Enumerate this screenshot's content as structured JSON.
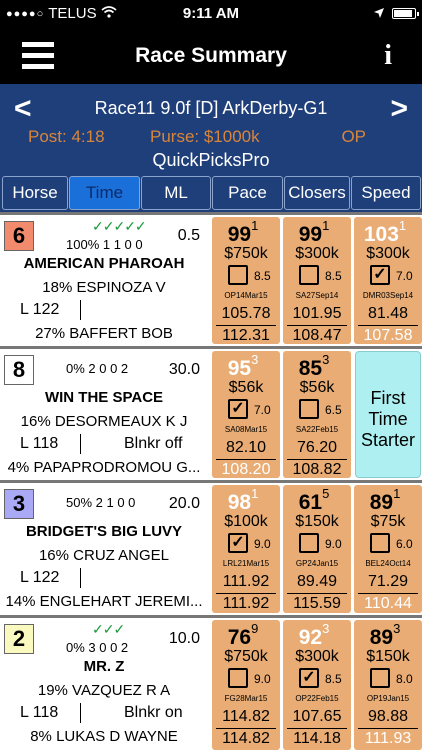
{
  "status_bar": {
    "carrier": "TELUS",
    "time": "9:11 AM"
  },
  "nav": {
    "title": "Race Summary",
    "info_label": "i"
  },
  "race": {
    "title": "Race11  9.0f  [D]  ArkDerby-G1",
    "post": "Post: 4:18",
    "purse": "Purse: $1000k",
    "type": "OP",
    "source": "QuickPicksPro",
    "prev_arrow": "<",
    "next_arrow": ">"
  },
  "tabs": [
    "Horse",
    "Time",
    "ML",
    "Pace",
    "Closers",
    "Speed"
  ],
  "active_tab": "Time",
  "colors": {
    "header_bg": "#1f3f7a",
    "tab_active": "#1a6fd8",
    "card": "#e8ac74",
    "first_time": "#aef0f2",
    "accent_orange": "#d9853a",
    "check_green": "#1a9a3a"
  },
  "horses": [
    {
      "pp": "6",
      "pp_color": "#f28b6e",
      "checks": "✓✓✓✓✓",
      "stats": "100% 1 1 0 0",
      "ml": "0.5",
      "name": "AMERICAN PHAROAH",
      "jockey": "18% ESPINOZA V",
      "weight": "L 122",
      "equip": "",
      "trainer": "27% BAFFERT BOB",
      "races": [
        {
          "fig": "99",
          "sup": "1",
          "claim": "$750k",
          "checked": false,
          "odds": "8.5",
          "date": "OP14Mar15",
          "t1": "105.78",
          "t2": "112.31",
          "t2_white": false
        },
        {
          "fig": "99",
          "sup": "1",
          "claim": "$300k",
          "checked": false,
          "odds": "8.5",
          "date": "SA27Sep14",
          "t1": "101.95",
          "t2": "108.47",
          "t2_white": false
        },
        {
          "fig": "103",
          "sup": "1",
          "claim": "$300k",
          "checked": true,
          "odds": "7.0",
          "date": "DMR03Sep14",
          "t1": "81.48",
          "t2": "107.58",
          "t2_white": true,
          "fig_white": true
        }
      ]
    },
    {
      "pp": "8",
      "pp_color": "#ffffff",
      "checks": "",
      "stats": "0% 2 0 0 2",
      "ml": "30.0",
      "name": "WIN THE SPACE",
      "jockey": "16% DESORMEAUX K J",
      "weight": "L 118",
      "equip": "Blnkr off",
      "trainer": "4% PAPAPRODROMOU G...",
      "races": [
        {
          "fig": "95",
          "sup": "3",
          "claim": "$56k",
          "checked": true,
          "odds": "7.0",
          "date": "SA08Mar15",
          "t1": "82.10",
          "t2": "108.20",
          "t2_white": true,
          "fig_white": true
        },
        {
          "fig": "85",
          "sup": "3",
          "claim": "$56k",
          "checked": false,
          "odds": "6.5",
          "date": "SA22Feb15",
          "t1": "76.20",
          "t2": "108.82",
          "t2_white": false
        }
      ],
      "first_time": "First Time Starter"
    },
    {
      "pp": "3",
      "pp_color": "#a9a9f5",
      "checks": "",
      "stats": "50% 2 1 0 0",
      "ml": "20.0",
      "name": "BRIDGET'S BIG LUVY",
      "jockey": "16% CRUZ ANGEL",
      "weight": "L 122",
      "equip": "",
      "trainer": "14% ENGLEHART JEREMI...",
      "races": [
        {
          "fig": "98",
          "sup": "1",
          "claim": "$100k",
          "checked": true,
          "odds": "9.0",
          "date": "LRL21Mar15",
          "t1": "111.92",
          "t2": "111.92",
          "t2_white": false,
          "fig_white": true
        },
        {
          "fig": "61",
          "sup": "5",
          "claim": "$150k",
          "checked": false,
          "odds": "9.0",
          "date": "GP24Jan15",
          "t1": "89.49",
          "t2": "115.59",
          "t2_white": false
        },
        {
          "fig": "89",
          "sup": "1",
          "claim": "$75k",
          "checked": false,
          "odds": "6.0",
          "date": "BEL24Oct14",
          "t1": "71.29",
          "t2": "110.44",
          "t2_white": true
        }
      ]
    },
    {
      "pp": "2",
      "pp_color": "#fafac0",
      "checks": "✓✓✓",
      "stats": "0% 3 0 0 2",
      "ml": "10.0",
      "name": "MR. Z",
      "jockey": "19% VAZQUEZ R A",
      "weight": "L 118",
      "equip": "Blnkr on",
      "trainer": "8% LUKAS D WAYNE",
      "races": [
        {
          "fig": "76",
          "sup": "9",
          "claim": "$750k",
          "checked": false,
          "odds": "9.0",
          "date": "FG28Mar15",
          "t1": "114.82",
          "t2": "114.82",
          "t2_white": false
        },
        {
          "fig": "92",
          "sup": "3",
          "claim": "$300k",
          "checked": true,
          "odds": "8.5",
          "date": "OP22Feb15",
          "t1": "107.65",
          "t2": "114.18",
          "t2_white": false,
          "fig_white": true
        },
        {
          "fig": "89",
          "sup": "3",
          "claim": "$150k",
          "checked": false,
          "odds": "8.0",
          "date": "OP19Jan15",
          "t1": "98.88",
          "t2": "111.93",
          "t2_white": true
        }
      ]
    }
  ]
}
